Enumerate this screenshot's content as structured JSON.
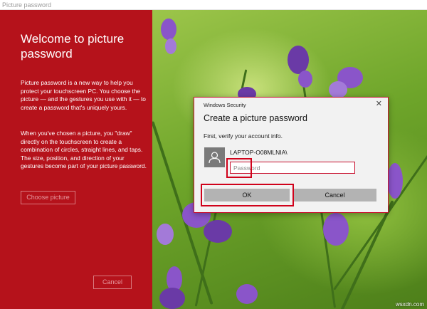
{
  "window": {
    "title": "Picture password"
  },
  "left_panel": {
    "heading": "Welcome to picture password",
    "paragraph1": "Picture password is a new way to help you protect your touchscreen PC. You choose the picture — and the gestures you use with it — to create a password that's uniquely yours.",
    "paragraph2": "When you've chosen a picture, you \"draw\" directly on the touchscreen to create a combination of circles, straight lines, and taps. The size, position, and direction of your gestures become part of your picture password.",
    "choose_button": "Choose picture",
    "cancel_button": "Cancel",
    "background_color": "#b5121b"
  },
  "dialog": {
    "caption": "Windows Security",
    "close_glyph": "✕",
    "title": "Create a picture password",
    "instruction": "First, verify your account info.",
    "account_name": "LAPTOP-O08MLNIA\\",
    "password_placeholder": "Password",
    "password_value": "",
    "ok_label": "OK",
    "cancel_label": "Cancel",
    "highlight_color": "#d0021b"
  },
  "icons": {
    "avatar": "user-icon",
    "close": "close-icon"
  },
  "watermark": "wsxdn.com"
}
